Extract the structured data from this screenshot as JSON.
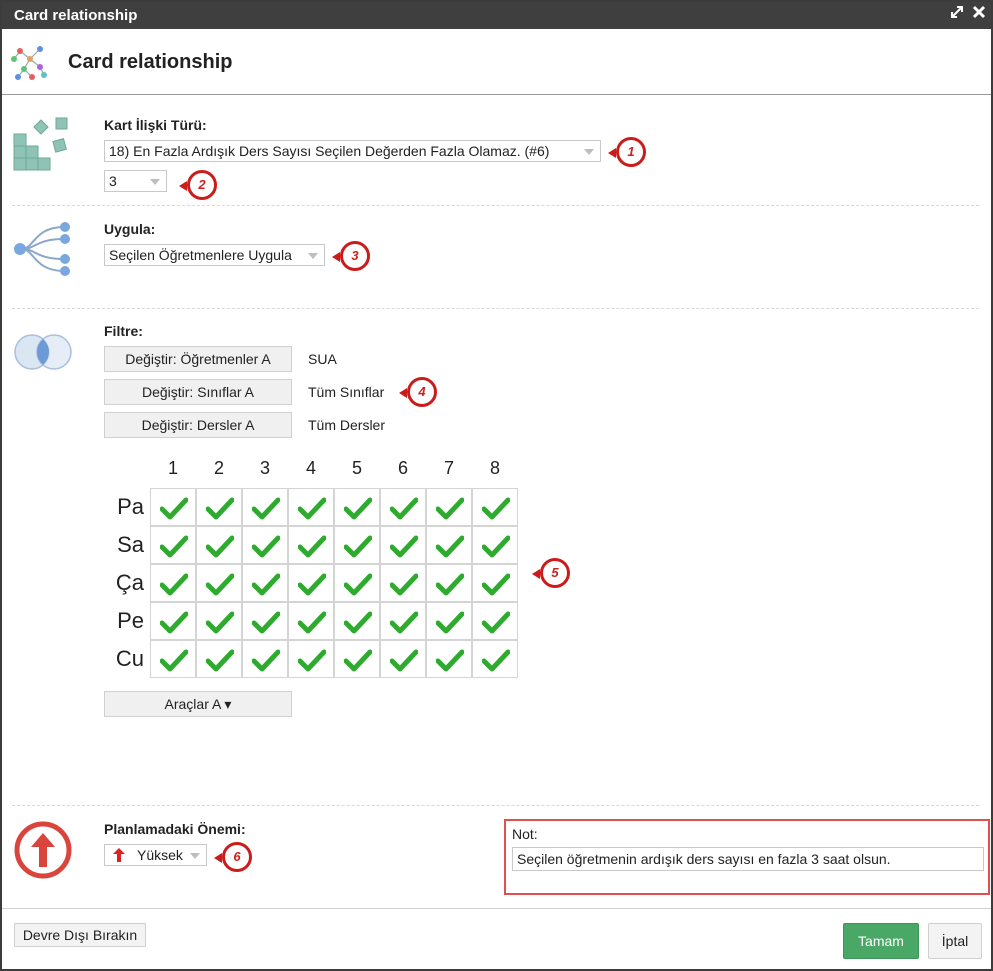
{
  "window": {
    "title": "Card relationship",
    "maximize_icon": "maximize-icon",
    "close_icon": "close-icon"
  },
  "header": {
    "title": "Card relationship",
    "icon": "network-graph-icon"
  },
  "relation_type": {
    "label": "Kart İlişki Türü:",
    "selected": "18) En Fazla Ardışık Ders Sayısı Seçilen Değerden Fazla Olamaz. (#6)",
    "value_selected": "3",
    "icon": "tiles-icon"
  },
  "apply": {
    "label": "Uygula:",
    "selected": "Seçilen Öğretmenlere Uygula",
    "icon": "tree-branch-icon"
  },
  "filter": {
    "label": "Filtre:",
    "icon": "venn-circles-icon",
    "rows": [
      {
        "button": "Değiştir: Öğretmenler A",
        "value": "SUA"
      },
      {
        "button": "Değiştir: Sınıflar A",
        "value": "Tüm Sınıflar"
      },
      {
        "button": "Değiştir: Dersler A",
        "value": "Tüm Dersler"
      }
    ]
  },
  "grid": {
    "columns": [
      "1",
      "2",
      "3",
      "4",
      "5",
      "6",
      "7",
      "8"
    ],
    "rows": [
      "Pa",
      "Sa",
      "Ça",
      "Pe",
      "Cu"
    ],
    "checked": [
      [
        true,
        true,
        true,
        true,
        true,
        true,
        true,
        true
      ],
      [
        true,
        true,
        true,
        true,
        true,
        true,
        true,
        true
      ],
      [
        true,
        true,
        true,
        true,
        true,
        true,
        true,
        true
      ],
      [
        true,
        true,
        true,
        true,
        true,
        true,
        true,
        true
      ],
      [
        true,
        true,
        true,
        true,
        true,
        true,
        true,
        true
      ]
    ],
    "check_color": "#2eab2e"
  },
  "tools_button": "Araçlar A ▾",
  "importance": {
    "label": "Planlamadaki Önemi:",
    "selected": "Yüksek",
    "icon": "arrow-up-circle-icon"
  },
  "note": {
    "label": "Not:",
    "value": "Seçilen öğretmenin ardışık ders sayısı en fazla 3 saat olsun."
  },
  "badges": [
    "1",
    "2",
    "3",
    "4",
    "5",
    "6"
  ],
  "footer": {
    "disable_label": "Devre Dışı Bırakın",
    "ok_label": "Tamam",
    "cancel_label": "İptal"
  },
  "colors": {
    "titlebar": "#3f3f3f",
    "ok_button": "#4aa867",
    "badge": "#cc1b1b",
    "importance_icon": "#d9453c"
  }
}
